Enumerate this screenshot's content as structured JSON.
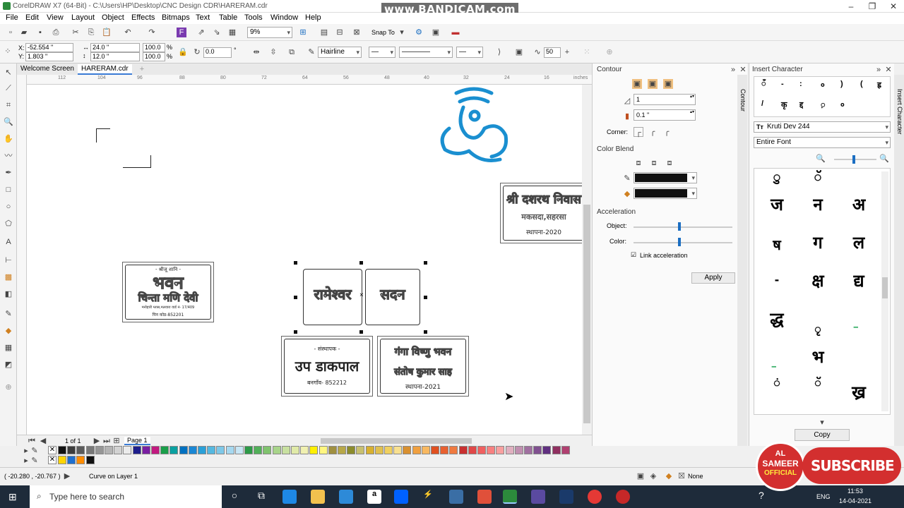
{
  "window": {
    "title": "CorelDRAW X7 (64-Bit) - C:\\Users\\HP\\Desktop\\CNC Design CDR\\HARERAM.cdr",
    "watermark": "www.BANDICAM.com"
  },
  "menu": [
    "File",
    "Edit",
    "View",
    "Layout",
    "Object",
    "Effects",
    "Bitmaps",
    "Text",
    "Table",
    "Tools",
    "Window",
    "Help"
  ],
  "toolbar1": {
    "zoom": "9%",
    "snap_to": "Snap To"
  },
  "property_bar": {
    "x": "-52.554 \"",
    "y": "1.803 \"",
    "width": "24.0 \"",
    "height": "12.0 \"",
    "scale_w": "100.0",
    "scale_h": "100.0",
    "percent": "%",
    "rotation": "0.0",
    "degree": "°",
    "outline_width": "Hairline",
    "smoothing": "50",
    "x_label": "X:",
    "y_label": "Y:"
  },
  "doc_tabs": [
    "Welcome Screen",
    "HARERAM.cdr"
  ],
  "ruler": {
    "ticks": [
      "112",
      "104",
      "96",
      "88",
      "80",
      "72",
      "64",
      "56",
      "48",
      "40",
      "32",
      "24",
      "16"
    ],
    "unit": "inches"
  },
  "plaques": {
    "bhavan": {
      "top": "- श्रीजू शानि -",
      "line1": "भवन",
      "line2": "चिन्ता मणि देवी",
      "line3": "मनोहारी ग्लास,मलवारा वार्ड नं- 17/409",
      "line4": "पिन कोड-852201"
    },
    "rameshwar": {
      "left": "रामेश्वर",
      "right": "सदन"
    },
    "upadakpal": {
      "top": "- संस्थापक -",
      "main": "उप डाकपाल",
      "bottom": "बनगाँव- 852212"
    },
    "ganga": {
      "line1": "गंगा विष्णु भवन",
      "line2": "संतोष कुमार साह",
      "line3": "स्थापना-2021"
    },
    "dashrath": {
      "line1": "श्री दशरथ निवास",
      "line2": "मकसदा,सहरसा",
      "line3": "स्थापना-2020"
    }
  },
  "page_nav": {
    "count": "1 of 1",
    "page": "Page 1"
  },
  "contour": {
    "title": "Contour",
    "steps": "1",
    "offset": "0.1 \"",
    "corner_label": "Corner:",
    "color_blend": "Color Blend",
    "acceleration": "Acceleration",
    "object_label": "Object:",
    "color_label": "Color:",
    "link_acceleration": "Link acceleration",
    "apply": "Apply",
    "side_tab": "Contour",
    "outline_color": "#111111",
    "fill_color": "#111111",
    "object_accel": 0.45,
    "color_accel": 0.45
  },
  "insert_char": {
    "title": "Insert Character",
    "recent_row1": [
      "ँ",
      "-",
      ":",
      "०",
      ")",
      "(",
      "ह्र"
    ],
    "recent_row2": [
      "/",
      "कृ",
      "द्द",
      "़",
      "०"
    ],
    "font": "Kruti Dev 244",
    "subset": "Entire Font",
    "grid": [
      "ु",
      "ॅ",
      "ज",
      "न",
      "अ",
      "ष",
      "ग",
      "ल",
      "-",
      "क्ष",
      "द्य",
      "द्ध",
      "ृ",
      "॒",
      "भ",
      "॒",
      "ं",
      "ॅ",
      "ख्र"
    ],
    "copy": "Copy",
    "side_tab": "Insert Character"
  },
  "palette": {
    "row1": [
      "#111111",
      "#3c3c3c",
      "#5a5a5a",
      "#787878",
      "#969696",
      "#b4b4b4",
      "#d2d2d2",
      "#ebebeb",
      "#1e1e8c",
      "#7a1fa2",
      "#c21a80",
      "#1a9e4a",
      "#0aa0a0",
      "#0070c0",
      "#1b87d4",
      "#2aa0d8",
      "#55b8e0",
      "#7ec8e8",
      "#a6d8f0",
      "#c8e6f5",
      "#2e9a48",
      "#52b05a",
      "#80c36e",
      "#a8d48a",
      "#c8e0a0",
      "#e0eaa8",
      "#f0f0b0",
      "#fff000",
      "#fff680",
      "#a09040",
      "#b8a848",
      "#8c8c2c",
      "#c8c070",
      "#d8b030",
      "#e0c050",
      "#f0d060",
      "#f8e090",
      "#d89030",
      "#f0a040",
      "#f8b860",
      "#e05020",
      "#e86030",
      "#f07a40",
      "#c83030",
      "#e04848",
      "#f06060",
      "#f88080",
      "#f8a0a0",
      "#e0b0c0",
      "#c090b0",
      "#a070a0",
      "#805090",
      "#603080",
      "#903060",
      "#b04070"
    ],
    "row2": [
      "#ffd400",
      "#1e6fd0",
      "#ff8c00",
      "#111111"
    ]
  },
  "status": {
    "coords": "( -20.280 , -20.767 )",
    "object": "Curve on Layer 1",
    "fill_none": "None"
  },
  "taskbar": {
    "search_placeholder": "Type here to search",
    "lang": "ENG",
    "time": "11:53",
    "date": "14-04-2021"
  },
  "badge": {
    "line1": "AL",
    "line2": "SAMEER",
    "line3": "OFFICIAL",
    "subscribe": "SUBSCRIBE"
  }
}
